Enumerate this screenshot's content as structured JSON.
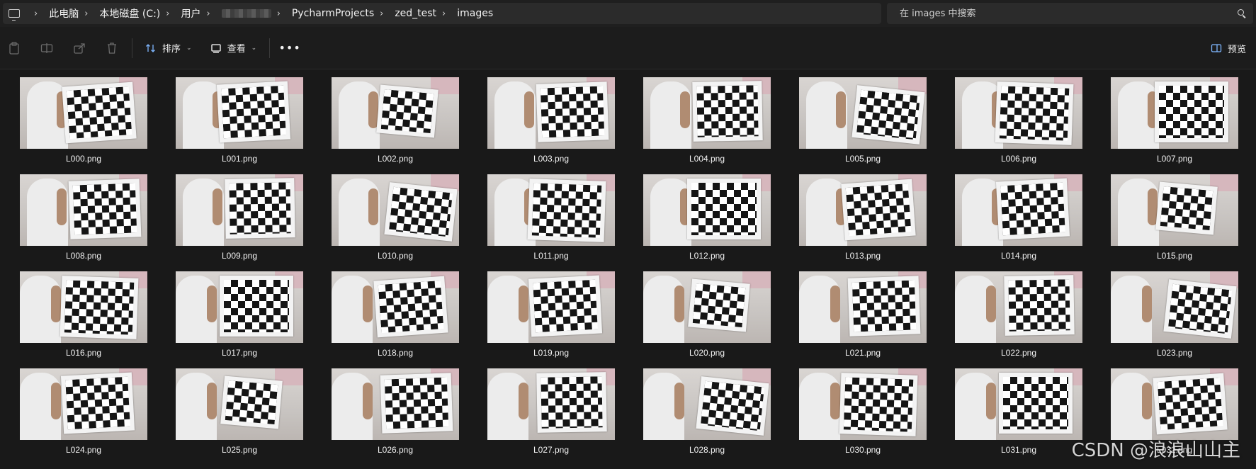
{
  "breadcrumb": {
    "items": [
      "此电脑",
      "本地磁盘 (C:)",
      "用户",
      "",
      "PycharmProjects",
      "zed_test",
      "images"
    ]
  },
  "search": {
    "placeholder": "在 images 中搜索"
  },
  "toolbar": {
    "sort_label": "排序",
    "view_label": "查看",
    "more_label": "•••",
    "preview_label": "预览"
  },
  "files": [
    "L000.png",
    "L001.png",
    "L002.png",
    "L003.png",
    "L004.png",
    "L005.png",
    "L006.png",
    "L007.png",
    "L008.png",
    "L009.png",
    "L010.png",
    "L011.png",
    "L012.png",
    "L013.png",
    "L014.png",
    "L015.png",
    "L016.png",
    "L017.png",
    "L018.png",
    "L019.png",
    "L020.png",
    "L021.png",
    "L022.png",
    "L023.png",
    "L024.png",
    "L025.png",
    "L026.png",
    "L027.png",
    "L028.png",
    "L030.png",
    "L031.png",
    "L032.png"
  ],
  "watermark": "CSDN @浪浪山山主",
  "colors": {
    "background": "#191919",
    "bar": "#2b2b2b",
    "text": "#ffffff"
  }
}
